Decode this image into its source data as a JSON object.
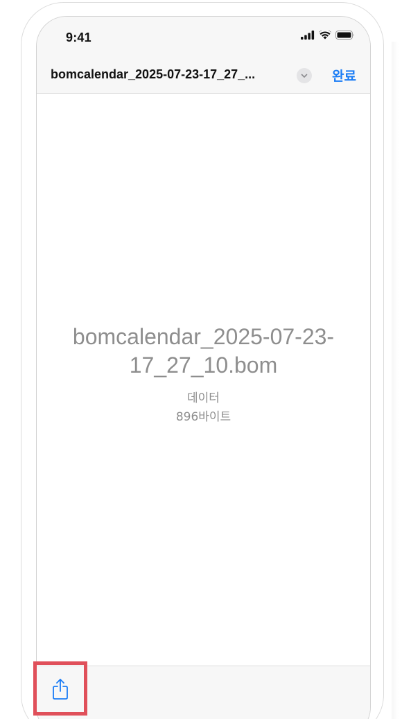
{
  "status_bar": {
    "time": "9:41",
    "icons": [
      "cellular-signal-icon",
      "wifi-icon",
      "battery-icon"
    ]
  },
  "nav": {
    "title": "bomcalendar_2025-07-23-17_27_...",
    "chevron_icon": "chevron-down-icon",
    "done_label": "완료"
  },
  "file": {
    "name": "bomcalendar_2025-07-23-17_27_10.bom",
    "name_line1": "bomcalendar_2025-07-23-",
    "name_line2": "17_27_10.bom",
    "kind": "데이터",
    "size": "896바이트"
  },
  "toolbar": {
    "share_icon": "share-icon"
  },
  "colors": {
    "accent": "#1a7cf5",
    "bar_background": "#f7f7f7",
    "secondary_text": "#8e8e8e",
    "highlight": "#e0505a"
  }
}
